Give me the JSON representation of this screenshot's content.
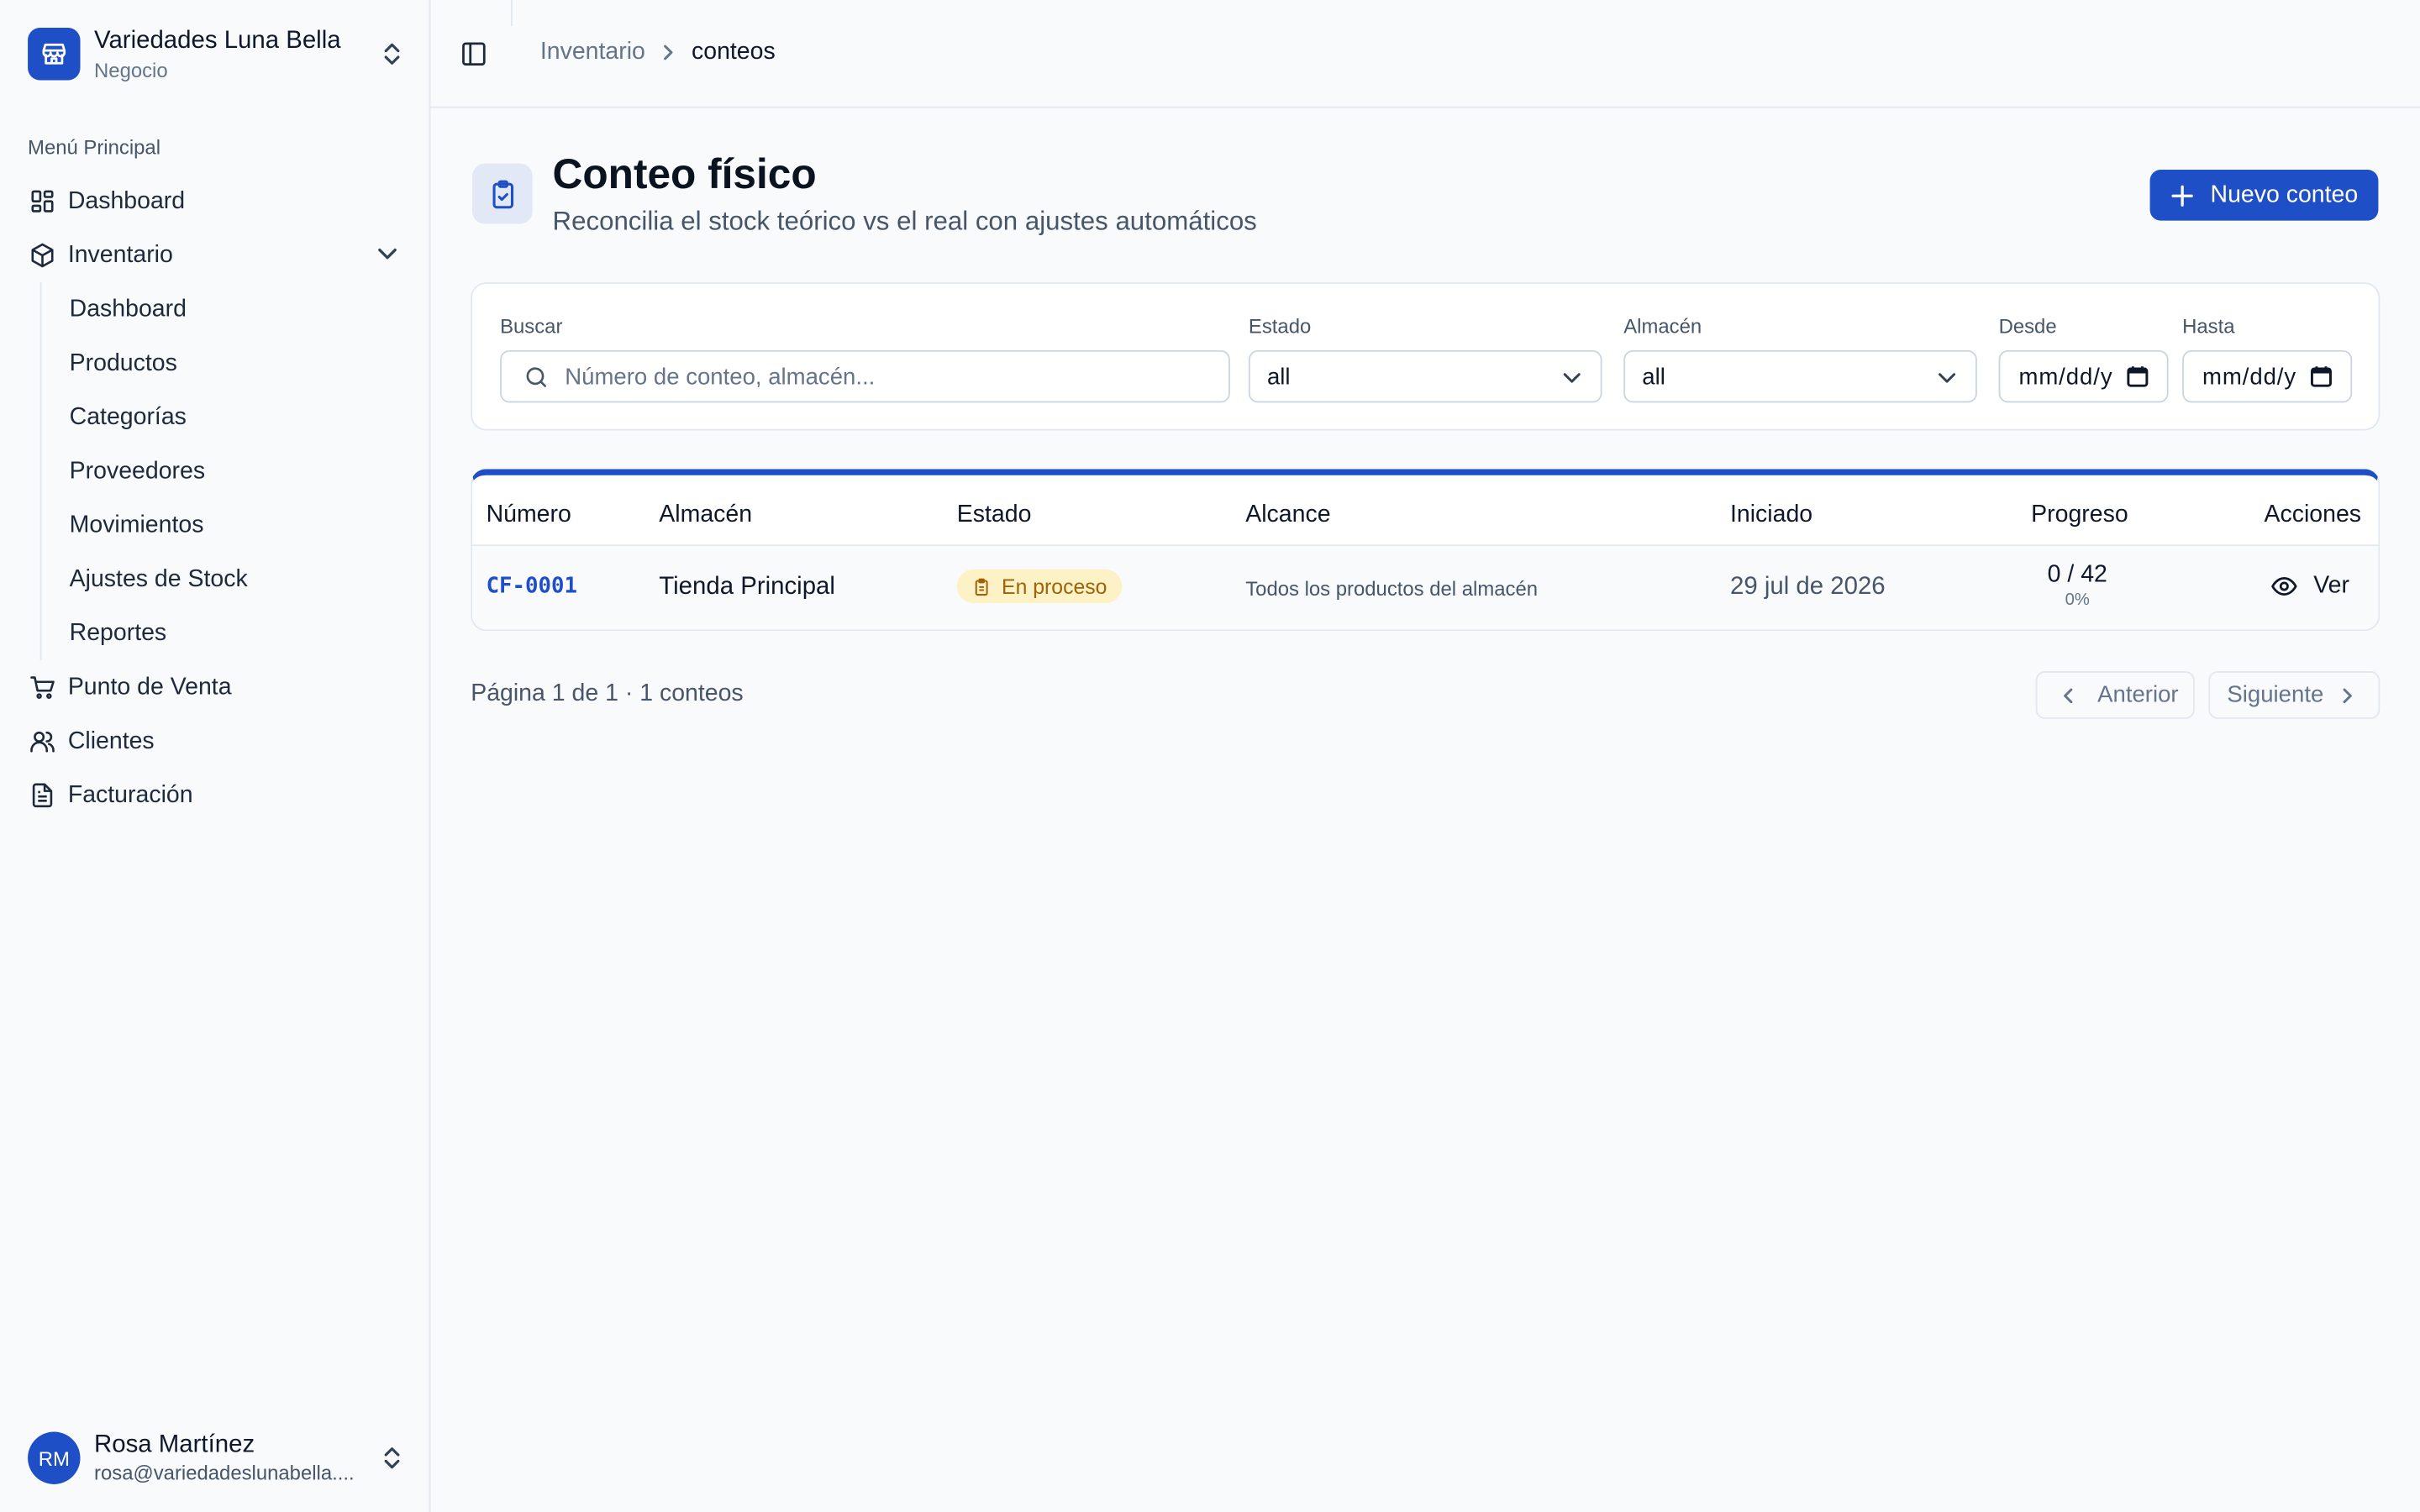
{
  "business": {
    "name": "Variedades Luna Bella",
    "type": "Negocio"
  },
  "sidebar": {
    "section_label": "Menú Principal",
    "items": [
      {
        "label": "Dashboard",
        "icon": "dashboard-icon"
      },
      {
        "label": "Inventario",
        "icon": "box-icon"
      },
      {
        "label": "Punto de Venta",
        "icon": "cart-icon"
      },
      {
        "label": "Clientes",
        "icon": "users-icon"
      },
      {
        "label": "Facturación",
        "icon": "file-icon"
      }
    ],
    "inventory_sub": [
      "Dashboard",
      "Productos",
      "Categorías",
      "Proveedores",
      "Movimientos",
      "Ajustes de Stock",
      "Reportes"
    ]
  },
  "user": {
    "initials": "RM",
    "name": "Rosa Martínez",
    "email": "rosa@variedadeslunabella...."
  },
  "breadcrumb": {
    "parent": "Inventario",
    "current": "conteos"
  },
  "page": {
    "title": "Conteo físico",
    "subtitle": "Reconcilia el stock teórico vs el real con ajustes automáticos",
    "new_button": "Nuevo conteo"
  },
  "filters": {
    "search_label": "Buscar",
    "search_placeholder": "Número de conteo, almacén...",
    "estado_label": "Estado",
    "estado_value": "all",
    "almacen_label": "Almacén",
    "almacen_value": "all",
    "desde_label": "Desde",
    "desde_value": "mm/dd/y",
    "hasta_label": "Hasta",
    "hasta_value": "mm/dd/y"
  },
  "table": {
    "columns": [
      "Número",
      "Almacén",
      "Estado",
      "Alcance",
      "Iniciado",
      "Progreso",
      "Acciones"
    ],
    "rows": [
      {
        "numero": "CF-0001",
        "almacen": "Tienda Principal",
        "estado": "En proceso",
        "alcance": "Todos los productos del almacén",
        "iniciado": "29 jul de 2026",
        "progreso": "0 / 42",
        "progreso_pct": "0%",
        "accion": "Ver"
      }
    ]
  },
  "pagination": {
    "info": "Página 1 de 1 · 1 conteos",
    "prev": "Anterior",
    "next": "Siguiente"
  },
  "colors": {
    "accent": "#1e4fc7",
    "badge_bg": "#fdf2c5",
    "badge_text": "#a16207"
  }
}
